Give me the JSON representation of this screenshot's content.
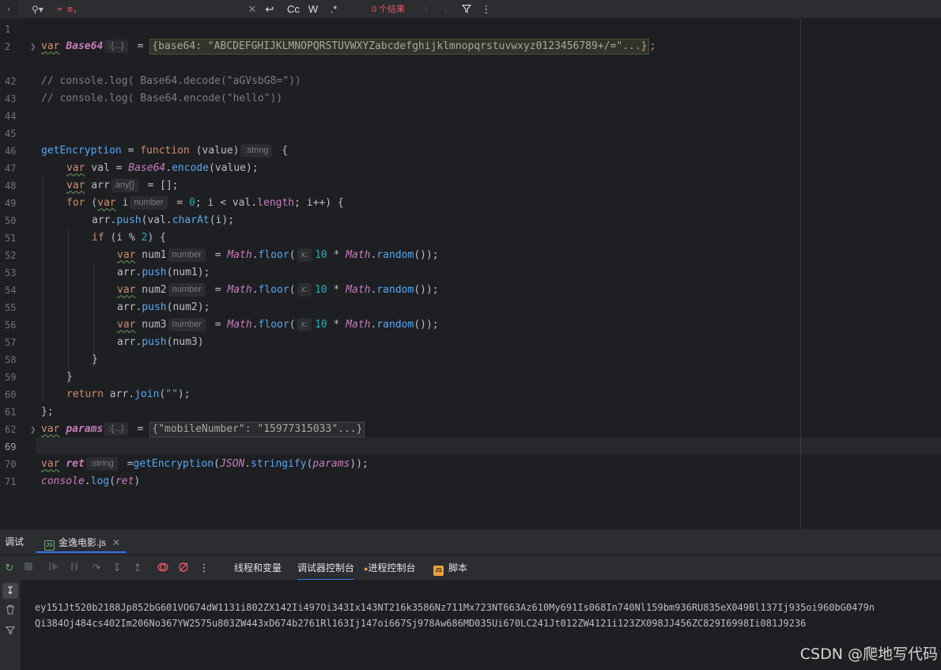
{
  "find_bar": {
    "gutter_icon": "chevron-right-icon",
    "search_icon": "search-icon",
    "query": "= m,",
    "clear_icon": "close-icon",
    "regex_wrap_icon": "wrap-icon",
    "case_label": "Cc",
    "word_label": "W",
    "regex_label": ".*",
    "result_text": "0 个结果",
    "prev_icon": "arrow-up-icon",
    "next_icon": "arrow-down-icon",
    "filter_icon": "filter-icon",
    "more_icon": "more-vertical-icon"
  },
  "editor": {
    "line_numbers": [
      "1",
      "2",
      "42",
      "43",
      "44",
      "45",
      "46",
      "47",
      "48",
      "49",
      "50",
      "51",
      "52",
      "53",
      "54",
      "55",
      "56",
      "57",
      "58",
      "59",
      "60",
      "61",
      "62",
      "69",
      "70",
      "71"
    ],
    "current_line": "69",
    "lines": {
      "l2": {
        "kw": "var",
        "name": "Base64",
        "hint": ":{...}",
        "eq": " = ",
        "folded": "{base64: \"ABCDEFGHIJKLMNOPQRSTUVWXYZabcdefghijklmnopqrstuvwxyz0123456789+/=\"...}",
        "end": ";"
      },
      "l42": "// console.log( Base64.decode(\"aGVsbG8=\"))",
      "l43": "// console.log( Base64.encode(\"hello\"))",
      "l46": {
        "name": "getEncryption",
        "eq": " = ",
        "kw": "function",
        "args": " (value)",
        "hint": ":string",
        "brace": " {"
      },
      "l47": {
        "kw": "var",
        "a": " val = ",
        "obj": "Base64",
        "dot": ".",
        "fn": "encode",
        "rest": "(value);"
      },
      "l48": {
        "kw": "var",
        "a": " arr",
        "hint": "any[]",
        "rest": " = [];"
      },
      "l49": {
        "kw": "for",
        "a": " (",
        "kw2": "var",
        "b": " i",
        "hint": "number",
        "c": " = ",
        "n": "0",
        "d": "; i < val.",
        "prop": "length",
        "e": "; i++) {"
      },
      "l50": {
        "a": "arr.",
        "fn": "push",
        "b": "(val.",
        "fn2": "charAt",
        "c": "(i);"
      },
      "l51": {
        "kw": "if",
        "a": " (i % ",
        "n": "2",
        "b": ") {"
      },
      "l52": {
        "kw": "var",
        "a": " num1",
        "hint": "number",
        "b": " = ",
        "cls": "Math",
        "c": ".",
        "fn": "floor",
        "d": "(",
        "hint2": "x:",
        "n": "10",
        "e": " * ",
        "cls2": "Math",
        "f": ".",
        "fn2": "random",
        "g": "());"
      },
      "l53": {
        "a": "arr.",
        "fn": "push",
        "b": "(num1);"
      },
      "l54": {
        "kw": "var",
        "a": " num2",
        "hint": "number",
        "b": " = ",
        "cls": "Math",
        "c": ".",
        "fn": "floor",
        "d": "(",
        "hint2": "x:",
        "n": "10",
        "e": " * ",
        "cls2": "Math",
        "f": ".",
        "fn2": "random",
        "g": "());"
      },
      "l55": {
        "a": "arr.",
        "fn": "push",
        "b": "(num2);"
      },
      "l56": {
        "kw": "var",
        "a": " num3",
        "hint": "number",
        "b": " = ",
        "cls": "Math",
        "c": ".",
        "fn": "floor",
        "d": "(",
        "hint2": "x:",
        "n": "10",
        "e": " * ",
        "cls2": "Math",
        "f": ".",
        "fn2": "random",
        "g": "());"
      },
      "l57": {
        "a": "arr.",
        "fn": "push",
        "b": "(num3)"
      },
      "l58": "}",
      "l59": "}",
      "l60": {
        "kw": "return",
        "a": " arr.",
        "fn": "join",
        "b": "(",
        "str": "\"\"",
        "c": ");"
      },
      "l61": "};",
      "l62": {
        "kw": "var",
        "name": "params",
        "hint": ":{...}",
        "eq": " = ",
        "folded": "{\"mobileNumber\": \"15977315033\"...}"
      },
      "l70": {
        "kw": "var",
        "name": "ret",
        "hint": ":string",
        "a": "=",
        "fn": "getEncryption",
        "b": "(",
        "obj": "JSON",
        "c": ".",
        "fn2": "stringify",
        "d": "(",
        "arg": "params",
        "e": "));"
      },
      "l71": {
        "obj": "console",
        "a": ".",
        "fn": "log",
        "b": "(",
        "arg": "ret",
        "c": ")"
      }
    }
  },
  "tool_window": {
    "title": "调试",
    "file_tab": "金逸电影.js",
    "js_badge": "JS",
    "tabs": [
      "线程和变量",
      "调试器控制台",
      "进程控制台",
      "脚本"
    ],
    "active_tab": "调试器控制台",
    "toolbar_icons": [
      "rerun-icon",
      "stop-icon",
      "resume-icon",
      "pause-icon",
      "step-over-icon",
      "step-into-icon",
      "step-out-icon",
      "view-breakpoints-icon",
      "mute-breakpoints-icon",
      "more-vertical-icon"
    ],
    "side_icons": [
      "scroll-to-end-icon",
      "clear-icon",
      "filter-icon"
    ],
    "console_lines": [
      "ey151Jt520b2188Jp852bG601VO674dW1131i802ZX142Ii497Oi343Ix143NT216k3586Nz711Mx723NT663Az610My691Is068In740Nl159bm936RU835eX049Bl137Ij935oi960bG0479n",
      "Qi384Oj484cs402Im206No367YW2575u803ZW443xD674b2761Rl163Ij147oi667Sj978Aw686MD035Ui670LC241Jt012ZW4121i123ZX098JJ456ZC829I6998Ii081J9236"
    ]
  },
  "watermark": "CSDN @爬地写代码"
}
